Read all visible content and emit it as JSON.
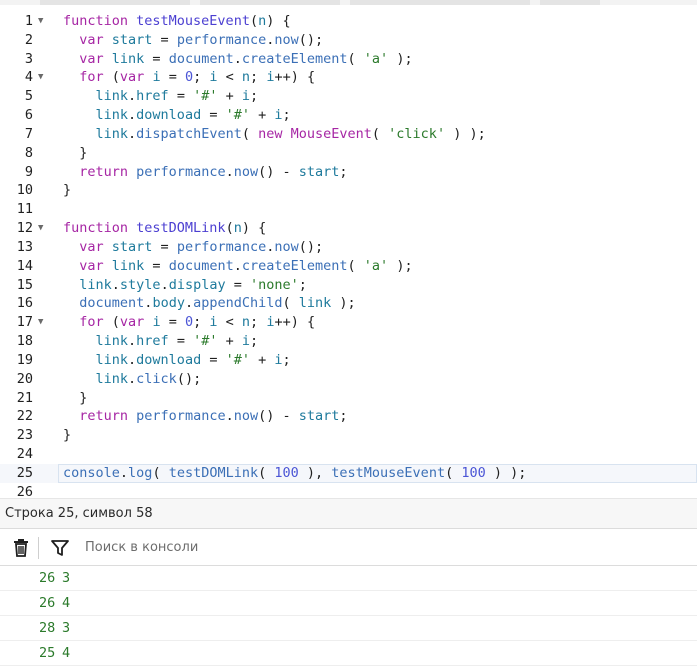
{
  "editor": {
    "lines": [
      {
        "n": "1",
        "fold": true,
        "tokens": [
          [
            "kw",
            "function "
          ],
          [
            "fn",
            "testMouseEvent"
          ],
          [
            "op",
            "("
          ],
          [
            "prop",
            "n"
          ],
          [
            "op",
            ") {"
          ]
        ]
      },
      {
        "n": "2",
        "fold": false,
        "tokens": [
          [
            "op",
            "  "
          ],
          [
            "kw",
            "var "
          ],
          [
            "prop",
            "start"
          ],
          [
            "op",
            " = "
          ],
          [
            "mth",
            "performance"
          ],
          [
            "op",
            "."
          ],
          [
            "mth",
            "now"
          ],
          [
            "op",
            "();"
          ]
        ]
      },
      {
        "n": "3",
        "fold": false,
        "tokens": [
          [
            "op",
            "  "
          ],
          [
            "kw",
            "var "
          ],
          [
            "prop",
            "link"
          ],
          [
            "op",
            " = "
          ],
          [
            "mth",
            "document"
          ],
          [
            "op",
            "."
          ],
          [
            "mth",
            "createElement"
          ],
          [
            "op",
            "( "
          ],
          [
            "str",
            "'a'"
          ],
          [
            "op",
            " );"
          ]
        ]
      },
      {
        "n": "4",
        "fold": true,
        "tokens": [
          [
            "op",
            "  "
          ],
          [
            "kw",
            "for "
          ],
          [
            "op",
            "("
          ],
          [
            "kw",
            "var "
          ],
          [
            "prop",
            "i"
          ],
          [
            "op",
            " = "
          ],
          [
            "num",
            "0"
          ],
          [
            "op",
            "; "
          ],
          [
            "prop",
            "i"
          ],
          [
            "op",
            " < "
          ],
          [
            "prop",
            "n"
          ],
          [
            "op",
            "; "
          ],
          [
            "prop",
            "i"
          ],
          [
            "op",
            "++) {"
          ]
        ]
      },
      {
        "n": "5",
        "fold": false,
        "tokens": [
          [
            "op",
            "    "
          ],
          [
            "prop",
            "link"
          ],
          [
            "op",
            "."
          ],
          [
            "prop",
            "href"
          ],
          [
            "op",
            " = "
          ],
          [
            "str",
            "'#'"
          ],
          [
            "op",
            " + "
          ],
          [
            "prop",
            "i"
          ],
          [
            "op",
            ";"
          ]
        ]
      },
      {
        "n": "6",
        "fold": false,
        "tokens": [
          [
            "op",
            "    "
          ],
          [
            "prop",
            "link"
          ],
          [
            "op",
            "."
          ],
          [
            "prop",
            "download"
          ],
          [
            "op",
            " = "
          ],
          [
            "str",
            "'#'"
          ],
          [
            "op",
            " + "
          ],
          [
            "prop",
            "i"
          ],
          [
            "op",
            ";"
          ]
        ]
      },
      {
        "n": "7",
        "fold": false,
        "tokens": [
          [
            "op",
            "    "
          ],
          [
            "prop",
            "link"
          ],
          [
            "op",
            "."
          ],
          [
            "mth",
            "dispatchEvent"
          ],
          [
            "op",
            "( "
          ],
          [
            "kw",
            "new "
          ],
          [
            "kw",
            "MouseEvent"
          ],
          [
            "op",
            "( "
          ],
          [
            "str",
            "'click'"
          ],
          [
            "op",
            " ) );"
          ]
        ]
      },
      {
        "n": "8",
        "fold": false,
        "tokens": [
          [
            "op",
            "  }"
          ]
        ]
      },
      {
        "n": "9",
        "fold": false,
        "tokens": [
          [
            "op",
            "  "
          ],
          [
            "kw",
            "return "
          ],
          [
            "mth",
            "performance"
          ],
          [
            "op",
            "."
          ],
          [
            "mth",
            "now"
          ],
          [
            "op",
            "() - "
          ],
          [
            "prop",
            "start"
          ],
          [
            "op",
            ";"
          ]
        ]
      },
      {
        "n": "10",
        "fold": false,
        "tokens": [
          [
            "op",
            "}"
          ]
        ]
      },
      {
        "n": "11",
        "fold": false,
        "tokens": []
      },
      {
        "n": "12",
        "fold": true,
        "tokens": [
          [
            "kw",
            "function "
          ],
          [
            "fn",
            "testDOMLink"
          ],
          [
            "op",
            "("
          ],
          [
            "prop",
            "n"
          ],
          [
            "op",
            ") {"
          ]
        ]
      },
      {
        "n": "13",
        "fold": false,
        "tokens": [
          [
            "op",
            "  "
          ],
          [
            "kw",
            "var "
          ],
          [
            "prop",
            "start"
          ],
          [
            "op",
            " = "
          ],
          [
            "mth",
            "performance"
          ],
          [
            "op",
            "."
          ],
          [
            "mth",
            "now"
          ],
          [
            "op",
            "();"
          ]
        ]
      },
      {
        "n": "14",
        "fold": false,
        "tokens": [
          [
            "op",
            "  "
          ],
          [
            "kw",
            "var "
          ],
          [
            "prop",
            "link"
          ],
          [
            "op",
            " = "
          ],
          [
            "mth",
            "document"
          ],
          [
            "op",
            "."
          ],
          [
            "mth",
            "createElement"
          ],
          [
            "op",
            "( "
          ],
          [
            "str",
            "'a'"
          ],
          [
            "op",
            " );"
          ]
        ]
      },
      {
        "n": "15",
        "fold": false,
        "tokens": [
          [
            "op",
            "  "
          ],
          [
            "prop",
            "link"
          ],
          [
            "op",
            "."
          ],
          [
            "prop",
            "style"
          ],
          [
            "op",
            "."
          ],
          [
            "prop",
            "display"
          ],
          [
            "op",
            " = "
          ],
          [
            "str",
            "'none'"
          ],
          [
            "op",
            ";"
          ]
        ]
      },
      {
        "n": "16",
        "fold": false,
        "tokens": [
          [
            "op",
            "  "
          ],
          [
            "mth",
            "document"
          ],
          [
            "op",
            "."
          ],
          [
            "prop",
            "body"
          ],
          [
            "op",
            "."
          ],
          [
            "mth",
            "appendChild"
          ],
          [
            "op",
            "( "
          ],
          [
            "prop",
            "link"
          ],
          [
            "op",
            " );"
          ]
        ]
      },
      {
        "n": "17",
        "fold": true,
        "tokens": [
          [
            "op",
            "  "
          ],
          [
            "kw",
            "for "
          ],
          [
            "op",
            "("
          ],
          [
            "kw",
            "var "
          ],
          [
            "prop",
            "i"
          ],
          [
            "op",
            " = "
          ],
          [
            "num",
            "0"
          ],
          [
            "op",
            "; "
          ],
          [
            "prop",
            "i"
          ],
          [
            "op",
            " < "
          ],
          [
            "prop",
            "n"
          ],
          [
            "op",
            "; "
          ],
          [
            "prop",
            "i"
          ],
          [
            "op",
            "++) {"
          ]
        ]
      },
      {
        "n": "18",
        "fold": false,
        "tokens": [
          [
            "op",
            "    "
          ],
          [
            "prop",
            "link"
          ],
          [
            "op",
            "."
          ],
          [
            "prop",
            "href"
          ],
          [
            "op",
            " = "
          ],
          [
            "str",
            "'#'"
          ],
          [
            "op",
            " + "
          ],
          [
            "prop",
            "i"
          ],
          [
            "op",
            ";"
          ]
        ]
      },
      {
        "n": "19",
        "fold": false,
        "tokens": [
          [
            "op",
            "    "
          ],
          [
            "prop",
            "link"
          ],
          [
            "op",
            "."
          ],
          [
            "prop",
            "download"
          ],
          [
            "op",
            " = "
          ],
          [
            "str",
            "'#'"
          ],
          [
            "op",
            " + "
          ],
          [
            "prop",
            "i"
          ],
          [
            "op",
            ";"
          ]
        ]
      },
      {
        "n": "20",
        "fold": false,
        "tokens": [
          [
            "op",
            "    "
          ],
          [
            "prop",
            "link"
          ],
          [
            "op",
            "."
          ],
          [
            "mth",
            "click"
          ],
          [
            "op",
            "();"
          ]
        ]
      },
      {
        "n": "21",
        "fold": false,
        "tokens": [
          [
            "op",
            "  }"
          ]
        ]
      },
      {
        "n": "22",
        "fold": false,
        "tokens": [
          [
            "op",
            "  "
          ],
          [
            "kw",
            "return "
          ],
          [
            "mth",
            "performance"
          ],
          [
            "op",
            "."
          ],
          [
            "mth",
            "now"
          ],
          [
            "op",
            "() - "
          ],
          [
            "prop",
            "start"
          ],
          [
            "op",
            ";"
          ]
        ]
      },
      {
        "n": "23",
        "fold": false,
        "tokens": [
          [
            "op",
            "}"
          ]
        ]
      },
      {
        "n": "24",
        "fold": false,
        "tokens": []
      },
      {
        "n": "25",
        "fold": false,
        "current": true,
        "tokens": [
          [
            "mth",
            "console"
          ],
          [
            "op",
            "."
          ],
          [
            "mth",
            "log"
          ],
          [
            "op",
            "( "
          ],
          [
            "mth",
            "testDOMLink"
          ],
          [
            "op",
            "( "
          ],
          [
            "num",
            "100"
          ],
          [
            "op",
            " ), "
          ],
          [
            "mth",
            "testMouseEvent"
          ],
          [
            "op",
            "( "
          ],
          [
            "num",
            "100"
          ],
          [
            "op",
            " ) );"
          ]
        ]
      },
      {
        "n": "26",
        "fold": false,
        "tokens": []
      }
    ]
  },
  "statusbar": {
    "position_text": "Строка 25, символ 58"
  },
  "toolbar": {
    "clear_icon": "trash-icon",
    "filter_icon": "filter-icon",
    "search_placeholder": "Поиск в консоли"
  },
  "console": {
    "rows": [
      {
        "a": "26",
        "b": "3"
      },
      {
        "a": "26",
        "b": "4"
      },
      {
        "a": "28",
        "b": "3"
      },
      {
        "a": "25",
        "b": "4"
      }
    ]
  },
  "colors": {
    "keyword": "#a626a4",
    "function_name": "#4b3fd1",
    "string": "#2b7a2b",
    "number": "#4b55d6",
    "console_output": "#2b7a2b"
  }
}
